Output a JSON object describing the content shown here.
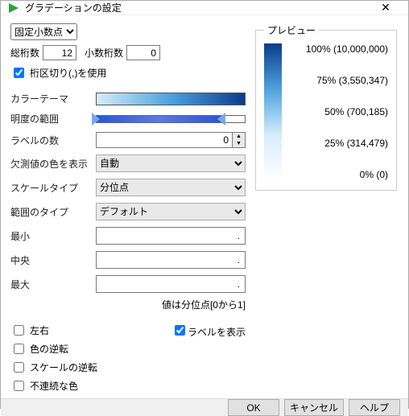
{
  "window": {
    "title": "グラデーションの設定"
  },
  "formatSelect": {
    "value": "固定小数点"
  },
  "digits": {
    "totalLabel": "総桁数",
    "totalValue": "12",
    "decLabel": "小数桁数",
    "decValue": "0"
  },
  "thousands": {
    "label": "桁区切り(,)を使用",
    "checked": true
  },
  "rows": {
    "colorTheme": "カラーテーマ",
    "brightness": "明度の範囲",
    "labelCount": "ラベルの数",
    "labelCountValue": "0",
    "missingColor": "欠測値の色を表示",
    "missingValue": "自動",
    "scaleType": "スケールタイプ",
    "scaleValue": "分位点",
    "rangeType": "範囲のタイプ",
    "rangeValue": "デフォルト",
    "min": "最小",
    "minValue": ".",
    "center": "中央",
    "centerValue": ".",
    "max": "最大",
    "maxValue": ".",
    "hint": "値は分位点[0から1]"
  },
  "checks": {
    "lr": "左右",
    "revColor": "色の逆転",
    "revScale": "スケールの逆転",
    "discrete": "不連続な色",
    "showLabel": "ラベルを表示"
  },
  "preview": {
    "legend": "プレビュー",
    "lines": [
      "100% (10,000,000)",
      "75% (3,550,347)",
      "50% (700,185)",
      "25% (314,479)",
      "0% (0)"
    ]
  },
  "buttons": {
    "ok": "OK",
    "cancel": "キャンセル",
    "help": "ヘルプ"
  }
}
